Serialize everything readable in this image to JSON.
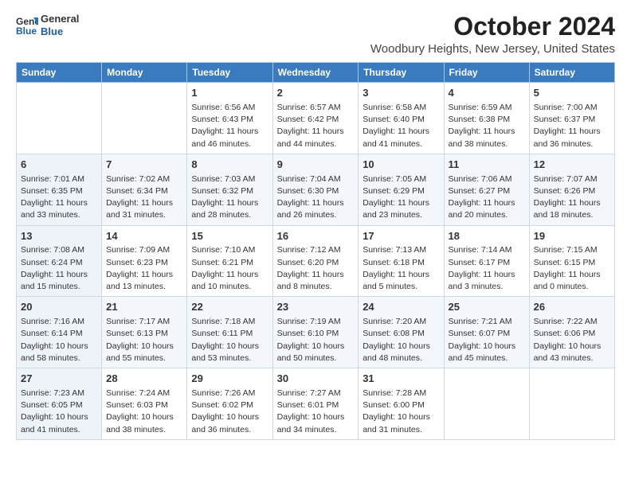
{
  "header": {
    "logo_line1": "General",
    "logo_line2": "Blue",
    "month": "October 2024",
    "location": "Woodbury Heights, New Jersey, United States"
  },
  "days_of_week": [
    "Sunday",
    "Monday",
    "Tuesday",
    "Wednesday",
    "Thursday",
    "Friday",
    "Saturday"
  ],
  "weeks": [
    [
      {
        "day": "",
        "sunrise": "",
        "sunset": "",
        "daylight": ""
      },
      {
        "day": "",
        "sunrise": "",
        "sunset": "",
        "daylight": ""
      },
      {
        "day": "1",
        "sunrise": "Sunrise: 6:56 AM",
        "sunset": "Sunset: 6:43 PM",
        "daylight": "Daylight: 11 hours and 46 minutes."
      },
      {
        "day": "2",
        "sunrise": "Sunrise: 6:57 AM",
        "sunset": "Sunset: 6:42 PM",
        "daylight": "Daylight: 11 hours and 44 minutes."
      },
      {
        "day": "3",
        "sunrise": "Sunrise: 6:58 AM",
        "sunset": "Sunset: 6:40 PM",
        "daylight": "Daylight: 11 hours and 41 minutes."
      },
      {
        "day": "4",
        "sunrise": "Sunrise: 6:59 AM",
        "sunset": "Sunset: 6:38 PM",
        "daylight": "Daylight: 11 hours and 38 minutes."
      },
      {
        "day": "5",
        "sunrise": "Sunrise: 7:00 AM",
        "sunset": "Sunset: 6:37 PM",
        "daylight": "Daylight: 11 hours and 36 minutes."
      }
    ],
    [
      {
        "day": "6",
        "sunrise": "Sunrise: 7:01 AM",
        "sunset": "Sunset: 6:35 PM",
        "daylight": "Daylight: 11 hours and 33 minutes."
      },
      {
        "day": "7",
        "sunrise": "Sunrise: 7:02 AM",
        "sunset": "Sunset: 6:34 PM",
        "daylight": "Daylight: 11 hours and 31 minutes."
      },
      {
        "day": "8",
        "sunrise": "Sunrise: 7:03 AM",
        "sunset": "Sunset: 6:32 PM",
        "daylight": "Daylight: 11 hours and 28 minutes."
      },
      {
        "day": "9",
        "sunrise": "Sunrise: 7:04 AM",
        "sunset": "Sunset: 6:30 PM",
        "daylight": "Daylight: 11 hours and 26 minutes."
      },
      {
        "day": "10",
        "sunrise": "Sunrise: 7:05 AM",
        "sunset": "Sunset: 6:29 PM",
        "daylight": "Daylight: 11 hours and 23 minutes."
      },
      {
        "day": "11",
        "sunrise": "Sunrise: 7:06 AM",
        "sunset": "Sunset: 6:27 PM",
        "daylight": "Daylight: 11 hours and 20 minutes."
      },
      {
        "day": "12",
        "sunrise": "Sunrise: 7:07 AM",
        "sunset": "Sunset: 6:26 PM",
        "daylight": "Daylight: 11 hours and 18 minutes."
      }
    ],
    [
      {
        "day": "13",
        "sunrise": "Sunrise: 7:08 AM",
        "sunset": "Sunset: 6:24 PM",
        "daylight": "Daylight: 11 hours and 15 minutes."
      },
      {
        "day": "14",
        "sunrise": "Sunrise: 7:09 AM",
        "sunset": "Sunset: 6:23 PM",
        "daylight": "Daylight: 11 hours and 13 minutes."
      },
      {
        "day": "15",
        "sunrise": "Sunrise: 7:10 AM",
        "sunset": "Sunset: 6:21 PM",
        "daylight": "Daylight: 11 hours and 10 minutes."
      },
      {
        "day": "16",
        "sunrise": "Sunrise: 7:12 AM",
        "sunset": "Sunset: 6:20 PM",
        "daylight": "Daylight: 11 hours and 8 minutes."
      },
      {
        "day": "17",
        "sunrise": "Sunrise: 7:13 AM",
        "sunset": "Sunset: 6:18 PM",
        "daylight": "Daylight: 11 hours and 5 minutes."
      },
      {
        "day": "18",
        "sunrise": "Sunrise: 7:14 AM",
        "sunset": "Sunset: 6:17 PM",
        "daylight": "Daylight: 11 hours and 3 minutes."
      },
      {
        "day": "19",
        "sunrise": "Sunrise: 7:15 AM",
        "sunset": "Sunset: 6:15 PM",
        "daylight": "Daylight: 11 hours and 0 minutes."
      }
    ],
    [
      {
        "day": "20",
        "sunrise": "Sunrise: 7:16 AM",
        "sunset": "Sunset: 6:14 PM",
        "daylight": "Daylight: 10 hours and 58 minutes."
      },
      {
        "day": "21",
        "sunrise": "Sunrise: 7:17 AM",
        "sunset": "Sunset: 6:13 PM",
        "daylight": "Daylight: 10 hours and 55 minutes."
      },
      {
        "day": "22",
        "sunrise": "Sunrise: 7:18 AM",
        "sunset": "Sunset: 6:11 PM",
        "daylight": "Daylight: 10 hours and 53 minutes."
      },
      {
        "day": "23",
        "sunrise": "Sunrise: 7:19 AM",
        "sunset": "Sunset: 6:10 PM",
        "daylight": "Daylight: 10 hours and 50 minutes."
      },
      {
        "day": "24",
        "sunrise": "Sunrise: 7:20 AM",
        "sunset": "Sunset: 6:08 PM",
        "daylight": "Daylight: 10 hours and 48 minutes."
      },
      {
        "day": "25",
        "sunrise": "Sunrise: 7:21 AM",
        "sunset": "Sunset: 6:07 PM",
        "daylight": "Daylight: 10 hours and 45 minutes."
      },
      {
        "day": "26",
        "sunrise": "Sunrise: 7:22 AM",
        "sunset": "Sunset: 6:06 PM",
        "daylight": "Daylight: 10 hours and 43 minutes."
      }
    ],
    [
      {
        "day": "27",
        "sunrise": "Sunrise: 7:23 AM",
        "sunset": "Sunset: 6:05 PM",
        "daylight": "Daylight: 10 hours and 41 minutes."
      },
      {
        "day": "28",
        "sunrise": "Sunrise: 7:24 AM",
        "sunset": "Sunset: 6:03 PM",
        "daylight": "Daylight: 10 hours and 38 minutes."
      },
      {
        "day": "29",
        "sunrise": "Sunrise: 7:26 AM",
        "sunset": "Sunset: 6:02 PM",
        "daylight": "Daylight: 10 hours and 36 minutes."
      },
      {
        "day": "30",
        "sunrise": "Sunrise: 7:27 AM",
        "sunset": "Sunset: 6:01 PM",
        "daylight": "Daylight: 10 hours and 34 minutes."
      },
      {
        "day": "31",
        "sunrise": "Sunrise: 7:28 AM",
        "sunset": "Sunset: 6:00 PM",
        "daylight": "Daylight: 10 hours and 31 minutes."
      },
      {
        "day": "",
        "sunrise": "",
        "sunset": "",
        "daylight": ""
      },
      {
        "day": "",
        "sunrise": "",
        "sunset": "",
        "daylight": ""
      }
    ]
  ]
}
